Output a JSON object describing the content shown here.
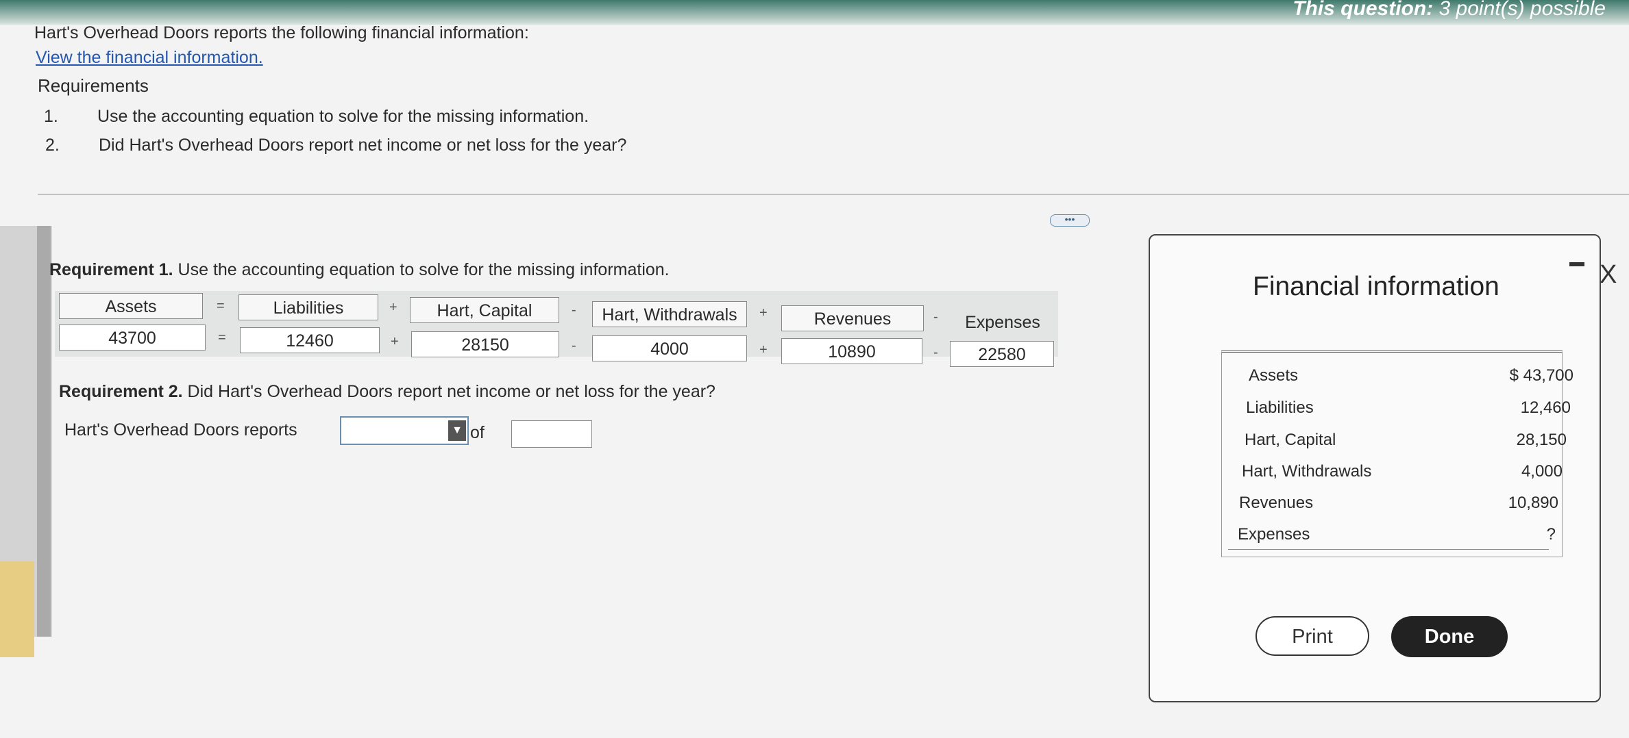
{
  "header": {
    "points_prefix": "This question:",
    "points_text": "3 point(s) possible"
  },
  "problem": {
    "intro": "Hart's Overhead Doors reports the following financial information:",
    "view_link": "View the financial information.",
    "requirements_title": "Requirements",
    "requirements": [
      {
        "num": "1.",
        "text": "Use the accounting equation to solve for the missing information."
      },
      {
        "num": "2.",
        "text": "Did Hart's Overhead Doors report net income or net loss for the year?"
      }
    ]
  },
  "requirement1": {
    "title_bold": "Requirement 1.",
    "title_rest": " Use the accounting equation to solve for the missing information.",
    "headers": [
      "Assets",
      "Liabilities",
      "Hart, Capital",
      "Hart, Withdrawals",
      "Revenues",
      "Expenses"
    ],
    "header_ops": [
      "=",
      "+",
      "-",
      "+",
      "-"
    ],
    "values": [
      "43700",
      "12460",
      "28150",
      "4000",
      "10890",
      "22580"
    ],
    "value_ops": [
      "=",
      "+",
      "-",
      "+",
      "-"
    ]
  },
  "requirement2": {
    "title_bold": "Requirement 2.",
    "title_rest": " Did Hart's Overhead Doors report net income or net loss for the year?",
    "reports_label": "Hart's Overhead Doors reports",
    "select_value": "",
    "of_label": "of",
    "amount_value": ""
  },
  "popup": {
    "title": "Financial information",
    "rows": [
      {
        "label": "Assets",
        "value": "$ 43,700"
      },
      {
        "label": "Liabilities",
        "value": "12,460"
      },
      {
        "label": "Hart, Capital",
        "value": "28,150"
      },
      {
        "label": "Hart, Withdrawals",
        "value": "4,000"
      },
      {
        "label": "Revenues",
        "value": "10,890"
      },
      {
        "label": "Expenses",
        "value": "?"
      }
    ],
    "print_label": "Print",
    "done_label": "Done",
    "close_glyph": "X"
  }
}
